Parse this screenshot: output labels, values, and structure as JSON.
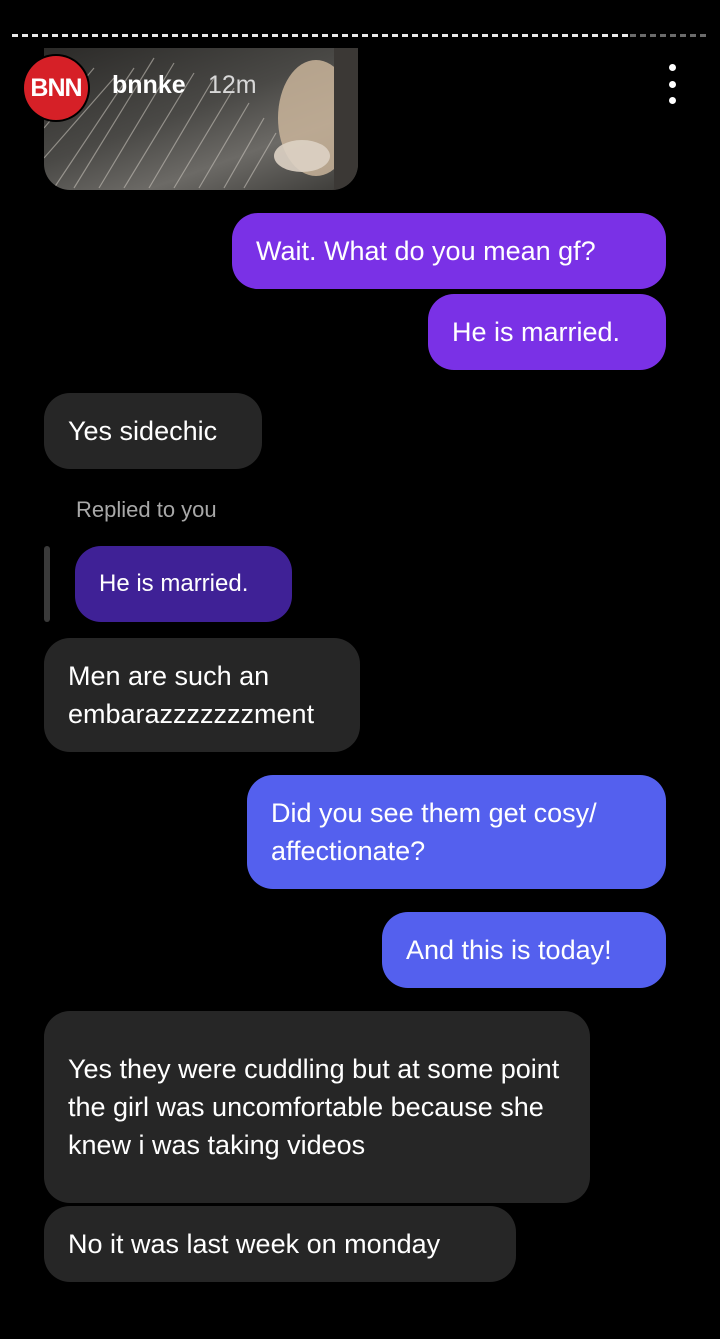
{
  "story": {
    "username": "bnnke",
    "time": "12m",
    "avatar_text": "BNN",
    "avatar_color": "#d62027"
  },
  "messages": [
    {
      "from": "me",
      "text": "Wait. What do you mean gf?"
    },
    {
      "from": "me",
      "text": "He is married."
    },
    {
      "from": "them",
      "text": "Yes sidechic"
    },
    {
      "from": "them",
      "reply_label": "Replied to you",
      "quoted": "He is married."
    },
    {
      "from": "them",
      "text": "Men are such an embarazzzzzzzment"
    },
    {
      "from": "me",
      "text": "Did you see them get cosy/ affectionate?"
    },
    {
      "from": "me",
      "text": "And this is today!"
    },
    {
      "from": "them",
      "text": "Yes they were cuddling but at some point the girl was uncomfortable because she knew i was taking videos"
    },
    {
      "from": "them",
      "text": "No it was last week on monday"
    }
  ],
  "colors": {
    "sent_purple": "#7a31e6",
    "sent_blue": "#5460ee",
    "received": "#262626",
    "quoted_bubble": "#3f2196"
  }
}
